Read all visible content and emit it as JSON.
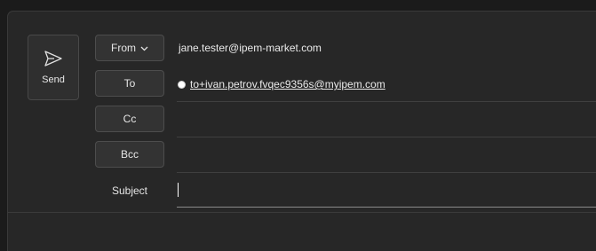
{
  "compose": {
    "send_label": "Send",
    "from_label": "From",
    "to_label": "To",
    "cc_label": "Cc",
    "bcc_label": "Bcc",
    "subject_label": "Subject",
    "from_address": "jane.tester@ipem-market.com",
    "to_recipients": [
      "to+ivan.petrov.fvqec9356s@myipem.com"
    ],
    "subject_value": ""
  },
  "icons": {
    "send": "send-icon",
    "from_dropdown": "chevron-down-icon",
    "presence": "presence-status-icon"
  },
  "colors": {
    "background": "#1b1b1b",
    "panel": "#272727",
    "button": "#333333",
    "text": "#eaeaea"
  }
}
